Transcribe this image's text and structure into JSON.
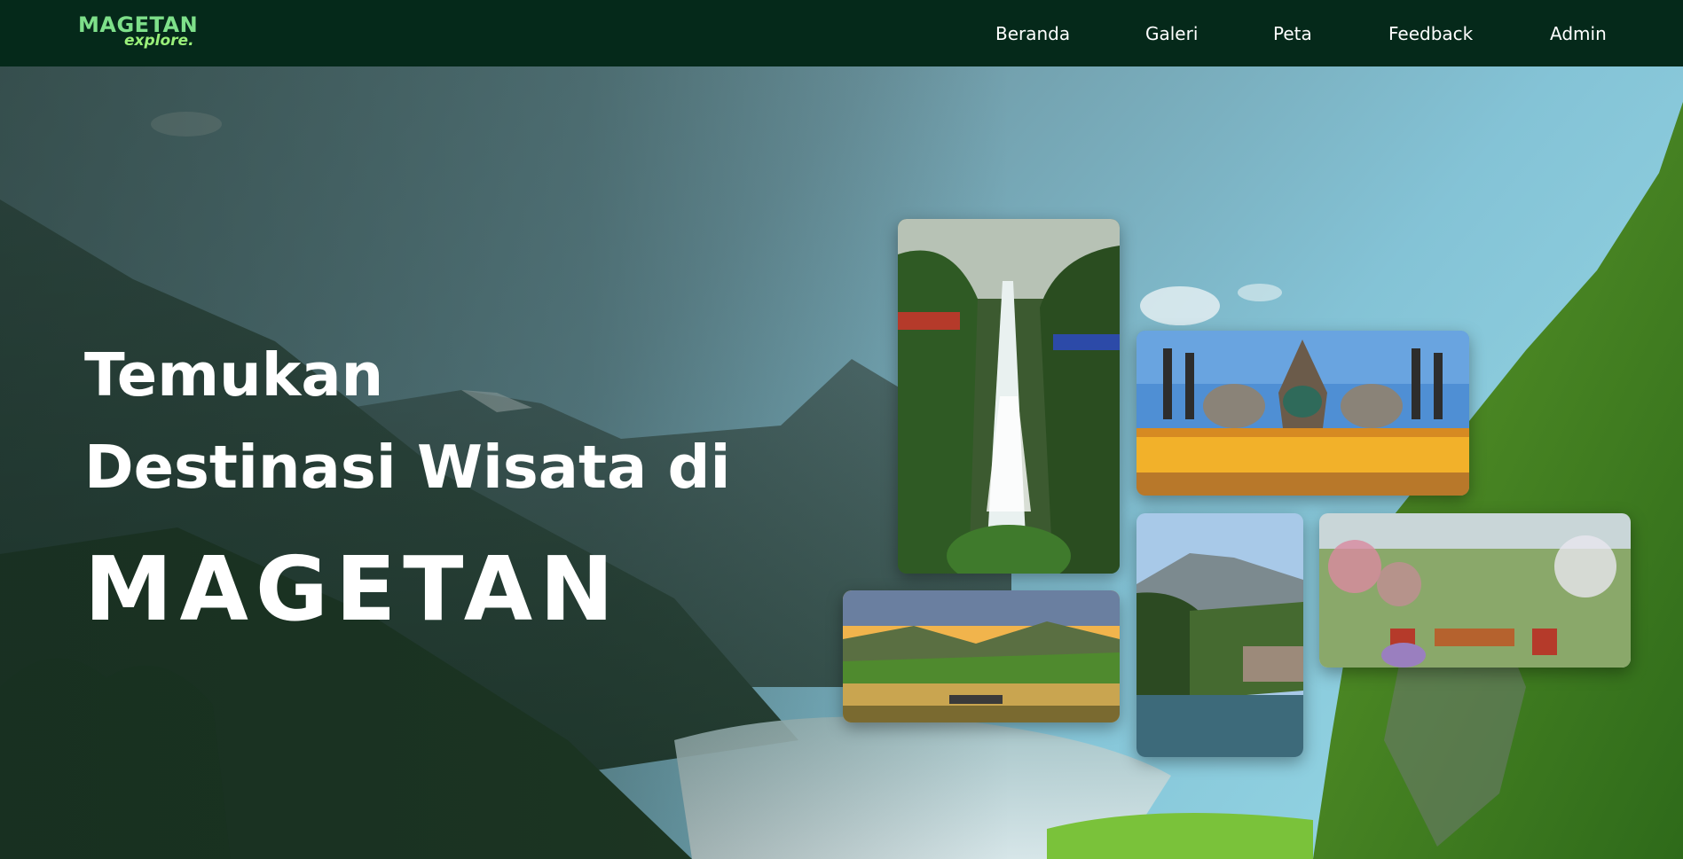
{
  "brand": {
    "logo_main": "MAGETAN",
    "logo_sub": "explore."
  },
  "nav": {
    "items": [
      {
        "label": "Beranda"
      },
      {
        "label": "Galeri"
      },
      {
        "label": "Peta"
      },
      {
        "label": "Feedback"
      },
      {
        "label": "Admin"
      }
    ]
  },
  "hero": {
    "line1": "Temukan",
    "line2": "Destinasi Wisata di",
    "line3": "MAGETAN"
  },
  "gallery": {
    "images": [
      {
        "name": "waterfall-photo"
      },
      {
        "name": "magetan-monument-photo"
      },
      {
        "name": "sunset-lake-photo"
      },
      {
        "name": "mountain-lake-photo"
      },
      {
        "name": "flower-garden-photo"
      }
    ]
  },
  "colors": {
    "navbar_bg": "#05291a",
    "logo_green": "#7ee08a",
    "text": "#ffffff"
  }
}
